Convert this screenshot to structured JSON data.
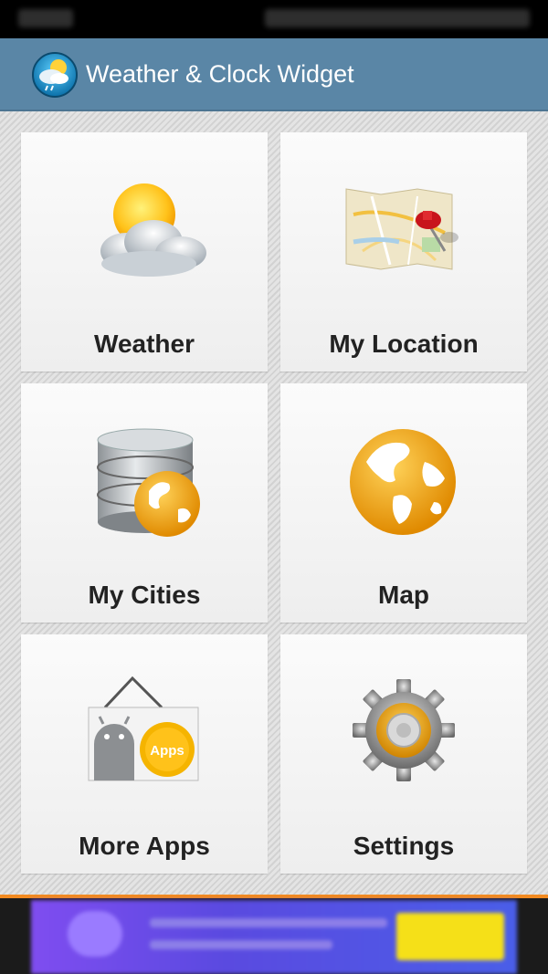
{
  "app": {
    "title": "Weather & Clock Widget"
  },
  "tiles": [
    {
      "label": "Weather",
      "icon": "weather-sun-cloud-icon"
    },
    {
      "label": "My Location",
      "icon": "map-pin-icon"
    },
    {
      "label": "My Cities",
      "icon": "database-globe-icon"
    },
    {
      "label": "Map",
      "icon": "globe-icon"
    },
    {
      "label": "More Apps",
      "icon": "android-apps-sign-icon"
    },
    {
      "label": "Settings",
      "icon": "gear-icon"
    }
  ],
  "apps_badge": "Apps",
  "colors": {
    "action_bar": "#5a86a6",
    "accent": "#f28a20",
    "globe": "#f5a800"
  }
}
